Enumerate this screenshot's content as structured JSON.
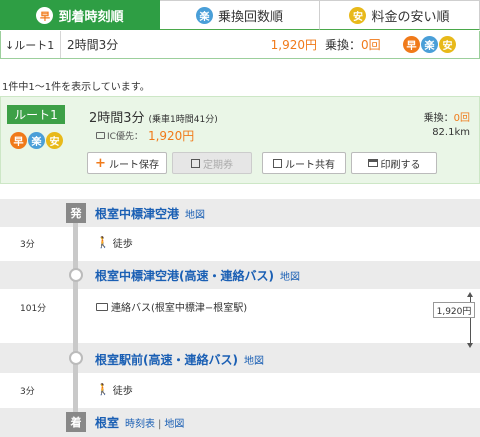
{
  "tabs": [
    {
      "label": "到着時刻順",
      "badge": "早"
    },
    {
      "label": "乗換回数順",
      "badge": "楽"
    },
    {
      "label": "料金の安い順",
      "badge": "安"
    }
  ],
  "summary": {
    "route": "↓ルート1",
    "duration": "2時間3分",
    "fare": "1,920円",
    "transfers_label": "乗換：",
    "transfers_value": "0回",
    "badges": [
      "早",
      "楽",
      "安"
    ]
  },
  "result_count": "1件中1〜1件を表示しています。",
  "route_detail": {
    "label": "ルート1",
    "duration": "2時間3分",
    "ride_time": "(乗車1時間41分)",
    "ic_label": "IC優先：",
    "fare": "1,920円",
    "transfers_label": "乗換：",
    "transfers_value": "0回",
    "distance": "82.1km",
    "badges": [
      "早",
      "楽",
      "安"
    ],
    "buttons": {
      "save": "ルート保存",
      "teiki": "定期券",
      "share": "ルート共有",
      "print": "印刷する"
    }
  },
  "timeline": {
    "depart_tag": "発",
    "arrive_tag": "着",
    "stops": [
      {
        "name": "根室中標津空港",
        "map": "地図"
      },
      {
        "name": "根室中標津空港(高速・連絡バス)",
        "map": "地図"
      },
      {
        "name": "根室駅前(高速・連絡バス)",
        "map": "地図"
      },
      {
        "name": "根室",
        "timetable": "時刻表",
        "sep": "|",
        "map": "地図"
      }
    ],
    "segments": [
      {
        "minutes": "3分",
        "mode": "徒歩"
      },
      {
        "minutes": "101分",
        "mode": "連絡バス(根室中標津−根室駅)"
      },
      {
        "minutes": "3分",
        "mode": "徒歩"
      }
    ],
    "segment_fare": "1,920円"
  }
}
